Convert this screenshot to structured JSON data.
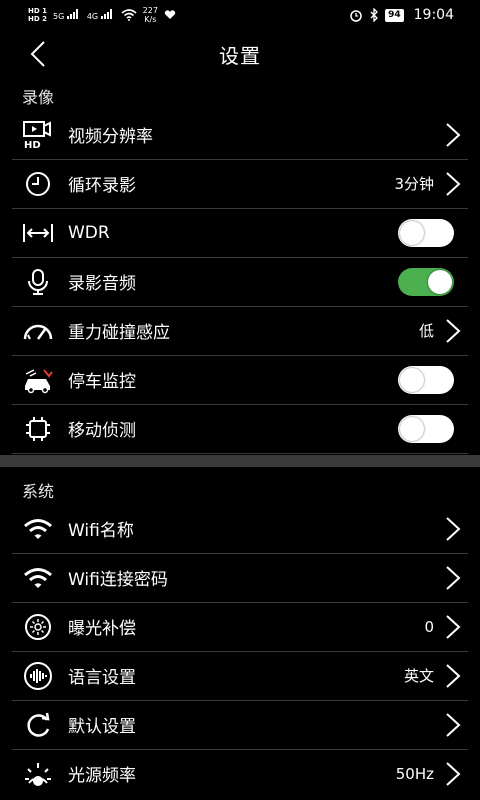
{
  "status_bar": {
    "hd1": "HD 1",
    "hd2": "HD 2",
    "signal1": "5G",
    "signal2": "4G",
    "speed_value": "227",
    "speed_unit": "K/s",
    "battery": "94",
    "time": "19:04"
  },
  "header": {
    "title": "设置"
  },
  "sections": {
    "recording": {
      "title": "录像",
      "items": [
        {
          "label": "视频分辨率",
          "value": ""
        },
        {
          "label": "循环录影",
          "value": "3分钟"
        },
        {
          "label": "WDR",
          "toggle": false
        },
        {
          "label": "录影音频",
          "toggle": true
        },
        {
          "label": "重力碰撞感应",
          "value": "低"
        },
        {
          "label": "停车监控",
          "toggle": false
        },
        {
          "label": "移动侦测",
          "toggle": false
        }
      ]
    },
    "system": {
      "title": "系统",
      "items": [
        {
          "label": "Wifi名称",
          "value": ""
        },
        {
          "label": "Wifi连接密码",
          "value": ""
        },
        {
          "label": "曝光补偿",
          "value": "0"
        },
        {
          "label": "语言设置",
          "value": "英文"
        },
        {
          "label": "默认设置",
          "value": ""
        },
        {
          "label": "光源频率",
          "value": "50Hz"
        }
      ]
    }
  },
  "colors": {
    "toggle_on": "#4caf50",
    "background": "#000000",
    "divider": "#3a3a3a"
  }
}
